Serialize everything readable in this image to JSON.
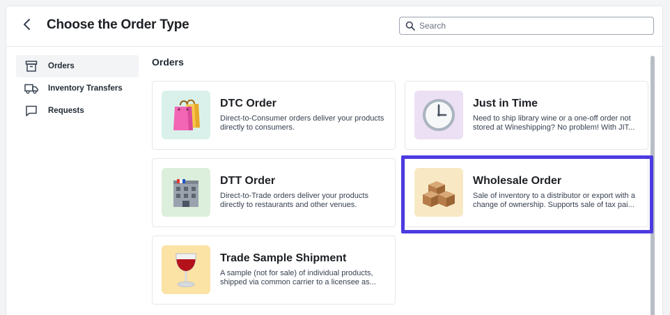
{
  "header": {
    "title": "Choose the Order Type",
    "back_icon": "chevron-left-icon",
    "search": {
      "placeholder": "Search",
      "value": "",
      "icon": "search-icon"
    }
  },
  "sidebar": {
    "items": [
      {
        "label": "Orders",
        "icon": "archive-box-icon",
        "active": true
      },
      {
        "label": "Inventory Transfers",
        "icon": "truck-icon",
        "active": false
      },
      {
        "label": "Requests",
        "icon": "chat-bubble-icon",
        "active": false
      }
    ]
  },
  "main": {
    "section_title": "Orders",
    "cards": [
      {
        "title": "DTC Order",
        "line1": "Direct-to-Consumer orders deliver your products",
        "line2": "directly to consumers.",
        "icon": "shopping-bags-icon",
        "bg": "#d9f1ea"
      },
      {
        "title": "Just in Time",
        "line1": "Need to ship library wine or a one-off order not",
        "line2": "stored at Wineshipping? No problem! With JIT...",
        "icon": "clock-icon",
        "bg": "#ece0f4"
      },
      {
        "title": "DTT Order",
        "line1": "Direct-to-Trade orders deliver your products",
        "line2": "directly to restaurants and other venues.",
        "icon": "building-icon",
        "bg": "#dcefdc"
      },
      {
        "title": "Wholesale Order",
        "line1": "Sale of inventory to a distributor or export with a",
        "line2": "change of ownership. Supports sale of tax pai...",
        "icon": "boxes-icon",
        "bg": "#f8e9c4"
      },
      {
        "title": "Trade Sample Shipment",
        "line1": "A sample (not for sale) of individual products,",
        "line2": "shipped via common carrier to a licensee as...",
        "icon": "wine-glass-icon",
        "bg": "#fbe3a6"
      }
    ]
  },
  "colors": {
    "highlight": "#4c3be0",
    "border": "#e5e7eb",
    "text": "#1f2933"
  }
}
